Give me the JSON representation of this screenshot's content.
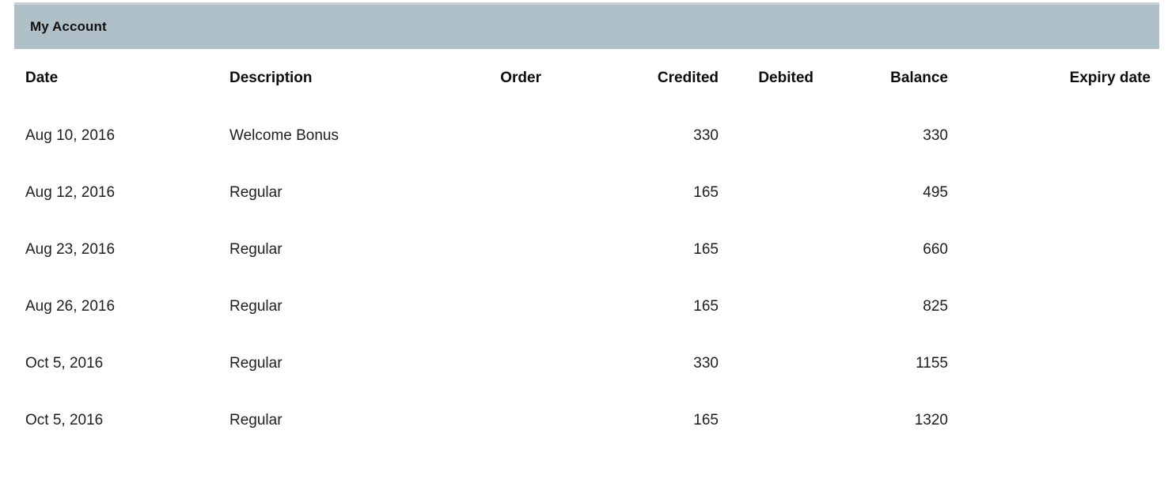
{
  "panel": {
    "title": "My Account",
    "header_bg": "#b0c0c9",
    "header_top_border": "#c6d2d9"
  },
  "table": {
    "columns": [
      {
        "key": "date",
        "label": "Date",
        "align": "left"
      },
      {
        "key": "description",
        "label": "Description",
        "align": "left"
      },
      {
        "key": "order",
        "label": "Order",
        "align": "right"
      },
      {
        "key": "credited",
        "label": "Credited",
        "align": "right"
      },
      {
        "key": "debited",
        "label": "Debited",
        "align": "right"
      },
      {
        "key": "balance",
        "label": "Balance",
        "align": "right"
      },
      {
        "key": "expiry",
        "label": "Expiry date",
        "align": "right"
      }
    ],
    "rows": [
      {
        "date": "Aug 10, 2016",
        "description": "Welcome Bonus",
        "order": "",
        "credited": "330",
        "debited": "",
        "balance": "330",
        "expiry": ""
      },
      {
        "date": "Aug 12, 2016",
        "description": "Regular",
        "order": "",
        "credited": "165",
        "debited": "",
        "balance": "495",
        "expiry": ""
      },
      {
        "date": "Aug 23, 2016",
        "description": "Regular",
        "order": "",
        "credited": "165",
        "debited": "",
        "balance": "660",
        "expiry": ""
      },
      {
        "date": "Aug 26, 2016",
        "description": "Regular",
        "order": "",
        "credited": "165",
        "debited": "",
        "balance": "825",
        "expiry": ""
      },
      {
        "date": "Oct 5, 2016",
        "description": "Regular",
        "order": "",
        "credited": "330",
        "debited": "",
        "balance": "1155",
        "expiry": ""
      },
      {
        "date": "Oct 5, 2016",
        "description": "Regular",
        "order": "",
        "credited": "165",
        "debited": "",
        "balance": "1320",
        "expiry": ""
      }
    ]
  }
}
